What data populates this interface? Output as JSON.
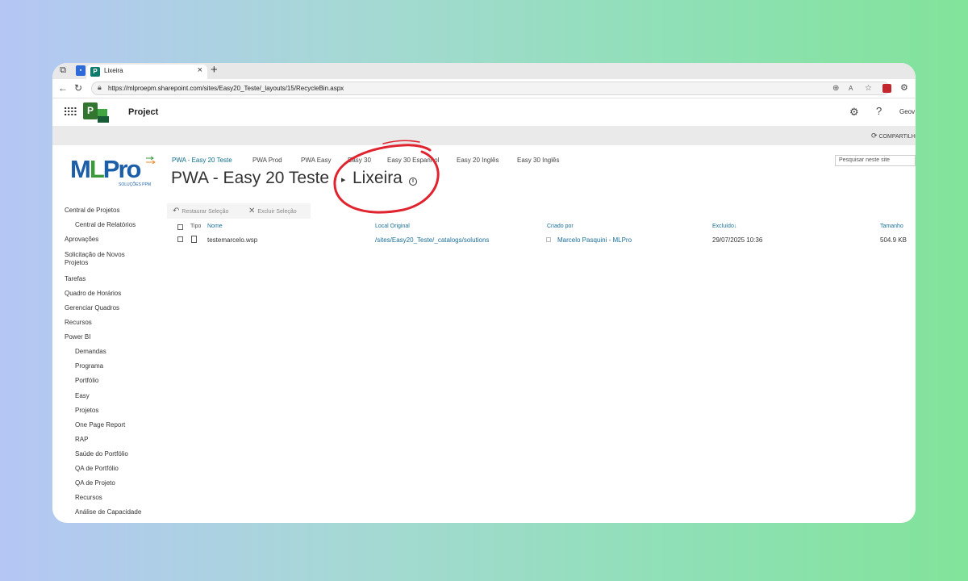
{
  "browser": {
    "tab_title": "Lixeira",
    "tab_favicon_letter": "P",
    "url": "https://mlproepm.sharepoint.com/sites/Easy20_Teste/_layouts/15/RecycleBin.aspx"
  },
  "suite": {
    "app_name": "Project",
    "logo_letter": "P",
    "user_name": "Geov",
    "share_label": "COMPARTILH"
  },
  "logo": {
    "main": "Pro",
    "main_first": "M",
    "main_l": "L",
    "sub": "SOLUÇÕES PPM"
  },
  "top_links": [
    "PWA - Easy 20 Teste",
    "PWA Prod",
    "PWA Easy",
    "Easy 30",
    "Easy 30 Espanhol",
    "Easy 20 Inglês",
    "Easy 30 Inglês"
  ],
  "page": {
    "site_title": "PWA - Easy 20 Teste",
    "breadcrumb_current": "Lixeira",
    "search_placeholder": "Pesquisar neste site"
  },
  "left_nav": [
    {
      "label": "Central de Projetos",
      "indent": false
    },
    {
      "label": "Central de Relatórios",
      "indent": true
    },
    {
      "label": "Aprovações",
      "indent": false
    },
    {
      "label": "Solicitação de Novos Projetos",
      "indent": false
    },
    {
      "label": "Tarefas",
      "indent": false
    },
    {
      "label": "Quadro de Horários",
      "indent": false
    },
    {
      "label": "Gerenciar Quadros",
      "indent": false
    },
    {
      "label": "Recursos",
      "indent": false
    },
    {
      "label": "Power BI",
      "indent": false
    },
    {
      "label": "Demandas",
      "indent": true
    },
    {
      "label": "Programa",
      "indent": true
    },
    {
      "label": "Portfólio",
      "indent": true
    },
    {
      "label": "Easy",
      "indent": true
    },
    {
      "label": "Projetos",
      "indent": true
    },
    {
      "label": "One Page Report",
      "indent": true
    },
    {
      "label": "RAP",
      "indent": true
    },
    {
      "label": "Saúde do Portfólio",
      "indent": true
    },
    {
      "label": "QA de Portfólio",
      "indent": true
    },
    {
      "label": "QA de Projeto",
      "indent": true
    },
    {
      "label": "Recursos",
      "indent": true
    },
    {
      "label": "Análise de Capacidade",
      "indent": true
    }
  ],
  "toolbar": {
    "restore_label": "Restaurar Seleção",
    "delete_label": "Excluir Seleção"
  },
  "table": {
    "headers": {
      "type": "Tipo",
      "name": "Nome",
      "original_location": "Local Original",
      "created_by": "Criado por",
      "deleted": "Excluído",
      "size": "Tamanho"
    },
    "rows": [
      {
        "name": "testemarcelo.wsp",
        "original_location": "/sites/Easy20_Teste/_catalogs/solutions",
        "created_by": "Marcelo Pasquini - MLPro",
        "deleted": "29/07/2025 10:36",
        "size": "504.9 KB"
      }
    ]
  },
  "colors": {
    "annotation_circle": "#e0242f",
    "link": "#1a6e96",
    "project_green": "#31752f"
  }
}
